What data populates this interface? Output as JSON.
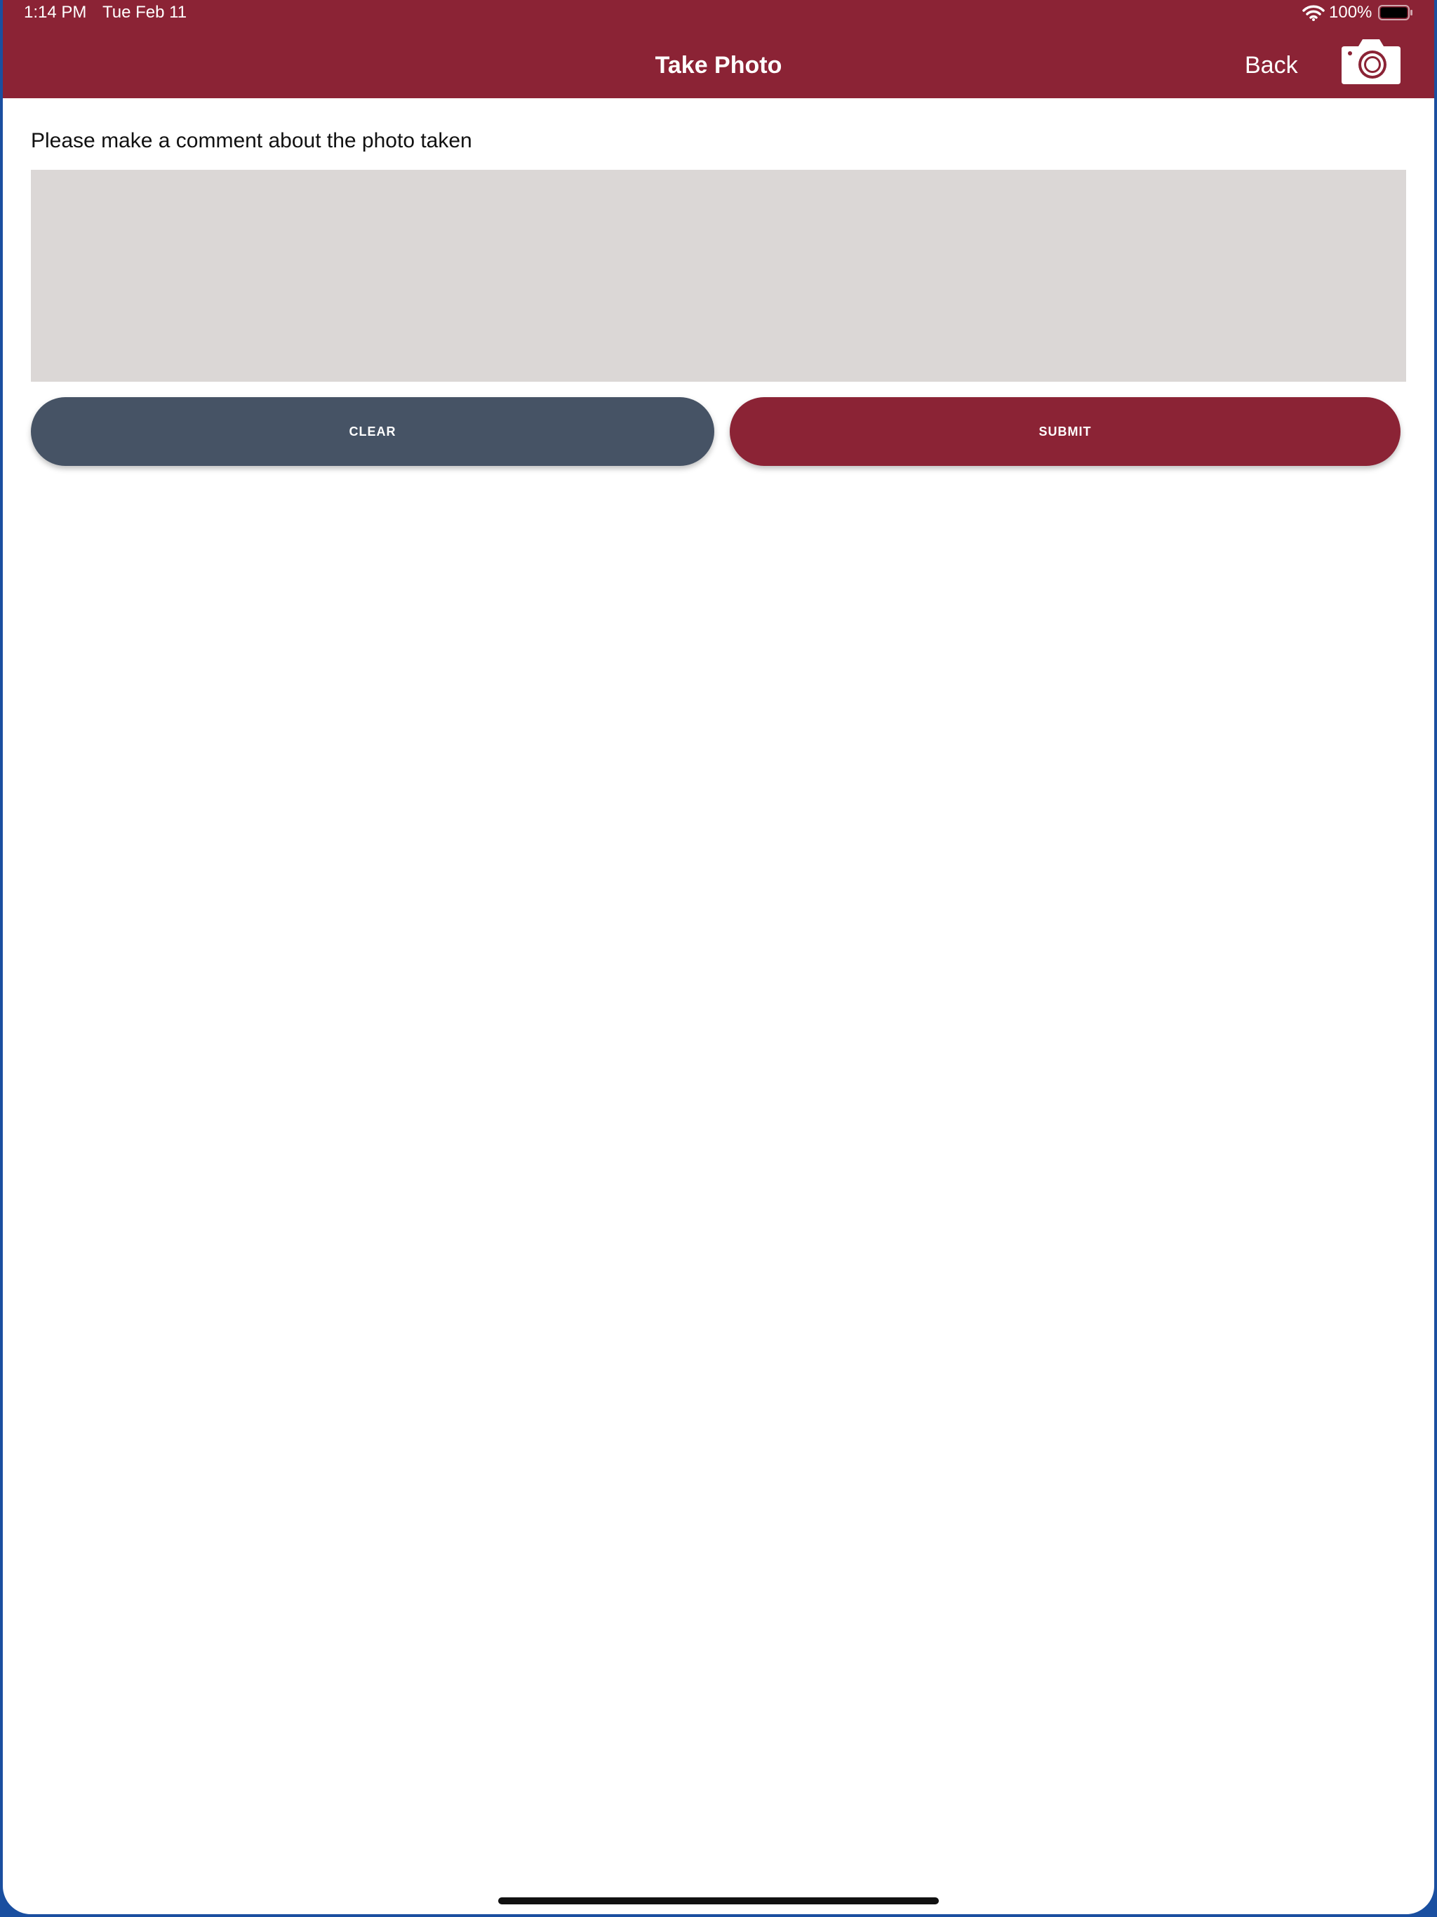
{
  "status_bar": {
    "time": "1:14 PM",
    "date": "Tue Feb 11",
    "battery_percent": "100%",
    "battery_level": 1.0
  },
  "header": {
    "title": "Take Photo",
    "back_label": "Back",
    "camera_icon": "camera-icon",
    "background_color": "#8b2335"
  },
  "form": {
    "prompt": "Please make a comment about the photo taken",
    "comment_value": "",
    "comment_placeholder": ""
  },
  "actions": {
    "clear_label": "CLEAR",
    "submit_label": "SUBMIT",
    "clear_color": "#465365",
    "submit_color": "#8b2335"
  }
}
